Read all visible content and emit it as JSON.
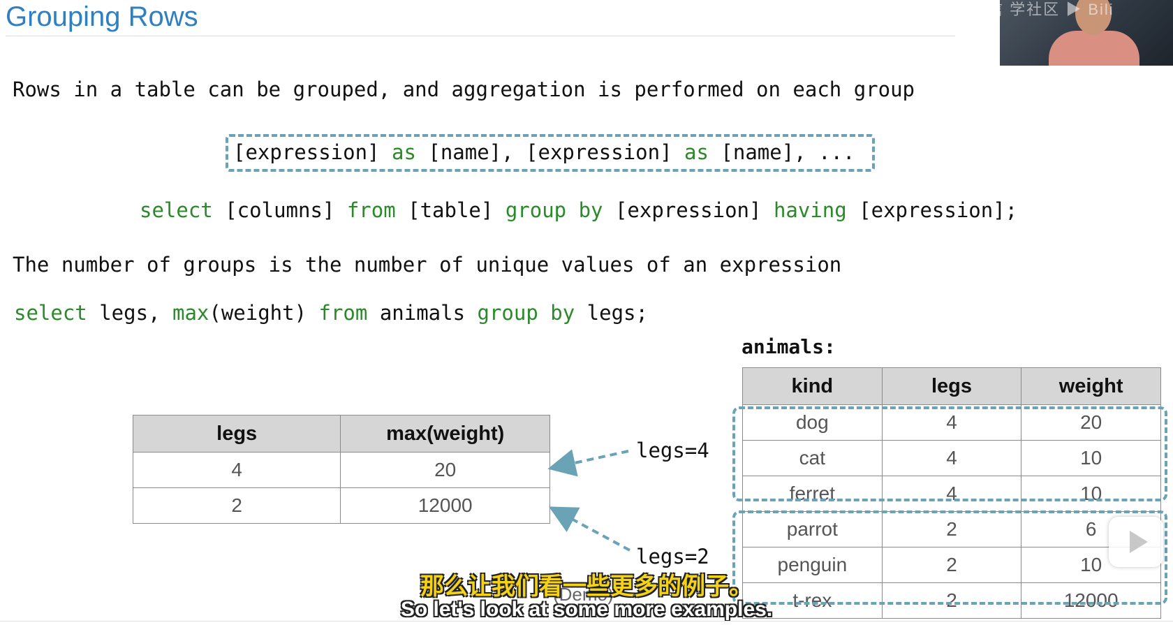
{
  "slide": {
    "title": "Grouping Rows",
    "intro": "Rows in a table can be grouped, and aggregation is performed on each group",
    "groups_note": "The number of groups is the number of unique values of an expression"
  },
  "expression_syntax": {
    "e1": "[expression] ",
    "as1": "as",
    "n1": " [name], [expression] ",
    "as2": "as",
    "n2": " [name], ..."
  },
  "select_syntax": {
    "kw_select": "select",
    "columns": " [columns] ",
    "kw_from": "from",
    "table": " [table] ",
    "kw_group_by": "group by",
    "expr1": " [expression] ",
    "kw_having": "having",
    "expr2": " [expression];"
  },
  "example_query": {
    "kw_select": "select",
    "t1": " legs, ",
    "fn_max": "max",
    "t2": "(weight) ",
    "kw_from": "from",
    "t3": " animals ",
    "kw_group_by": "group by",
    "t4": " legs;"
  },
  "result_table": {
    "headers": [
      "legs",
      "max(weight)"
    ],
    "rows": [
      [
        "4",
        "20"
      ],
      [
        "2",
        "12000"
      ]
    ]
  },
  "animals_table": {
    "label": "animals:",
    "headers": [
      "kind",
      "legs",
      "weight"
    ],
    "rows": [
      [
        "dog",
        "4",
        "20"
      ],
      [
        "cat",
        "4",
        "10"
      ],
      [
        "ferret",
        "4",
        "10"
      ],
      [
        "parrot",
        "2",
        "6"
      ],
      [
        "penguin",
        "2",
        "10"
      ],
      [
        "t-rex",
        "2",
        "12000"
      ]
    ]
  },
  "group_labels": {
    "g4": "legs=4",
    "g2": "legs=2"
  },
  "demo_label": "(Demo)",
  "subtitles": {
    "zh": "那么让我们看一些更多的例子。",
    "en": "So let's look at some more examples."
  },
  "watermark": "3B 信 学社区 ▶ Bili",
  "colors": {
    "title_blue": "#2f7fc1",
    "keyword_green": "#2a8a2a",
    "dashed_teal": "#6aa3b6",
    "header_gray": "#d6d6d6",
    "subtitle_yellow": "#f4d216"
  },
  "icons": {
    "play": "play-icon"
  }
}
